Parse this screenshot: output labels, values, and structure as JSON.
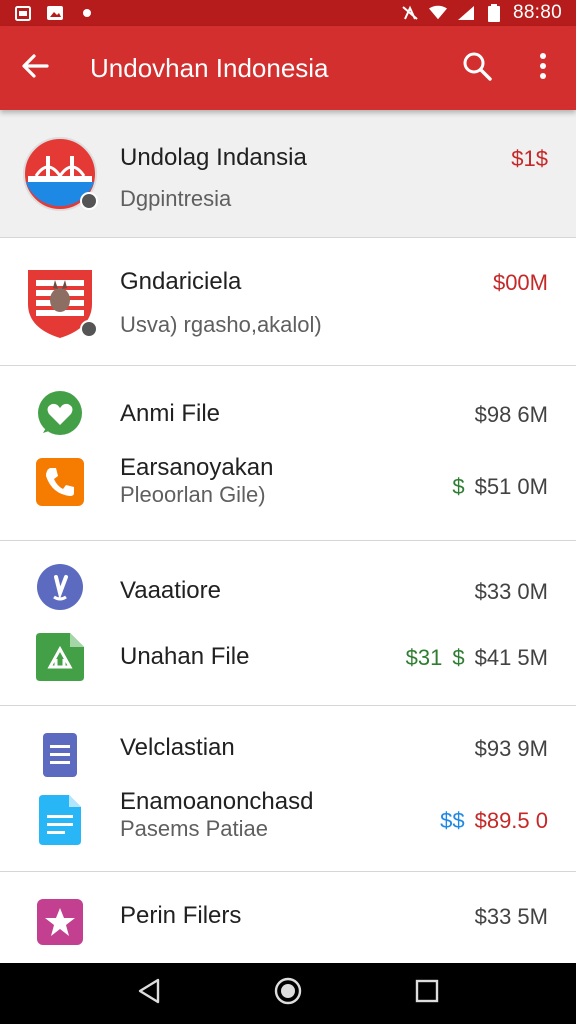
{
  "status_bar": {
    "time": "88:80",
    "icons": [
      "calendar-icon",
      "image-icon",
      "dot-icon",
      "signal-off-icon",
      "wifi-icon",
      "cell-signal-icon",
      "battery-icon"
    ]
  },
  "app_bar": {
    "title": "Undovhan Indonesia",
    "back_icon": "arrow-back-icon",
    "search_icon": "search-icon",
    "menu_icon": "more-vert-icon"
  },
  "groups": [
    {
      "rows": [
        {
          "title": "Undolag Indansia",
          "subtitle": "Dgpintresia",
          "amounts": [
            {
              "text": "$1$",
              "color": "red"
            }
          ],
          "icon": "flag-bridge-icon"
        }
      ]
    },
    {
      "rows": [
        {
          "title": "Gndariciela",
          "subtitle": "Usva) rgasho,akalol)",
          "amounts": [
            {
              "text": "$00M",
              "color": "red"
            }
          ],
          "icon": "kangaroo-flag-icon"
        }
      ]
    },
    {
      "rows": [
        {
          "title": "Anmi File",
          "subtitle": "",
          "amounts": [
            {
              "text": "$98 6M",
              "color": "gray"
            }
          ],
          "icon": "chat-bubble-icon"
        },
        {
          "title": "Earsanoyakan",
          "subtitle": "Pleoorlan Gile)",
          "amounts": [
            {
              "text": "$",
              "color": "green"
            },
            {
              "text": "$51 0M",
              "color": "gray"
            }
          ],
          "icon": "phone-icon"
        }
      ]
    },
    {
      "rows": [
        {
          "title": "Vaaatiore",
          "subtitle": "",
          "amounts": [
            {
              "text": "$33 0M",
              "color": "gray"
            }
          ],
          "icon": "viber-icon"
        },
        {
          "title": "Unahan File",
          "subtitle": "",
          "amounts": [
            {
              "text": "$31",
              "color": "green"
            },
            {
              "text": "$",
              "color": "green"
            },
            {
              "text": "$41 5M",
              "color": "gray"
            }
          ],
          "icon": "green-file-icon"
        }
      ]
    },
    {
      "rows": [
        {
          "title": "Velclastian",
          "subtitle": "",
          "amounts": [
            {
              "text": "$93 9M",
              "color": "gray"
            }
          ],
          "icon": "document-icon"
        },
        {
          "title": "Enamoanonchasd",
          "subtitle": "Pasems Patiae",
          "amounts": [
            {
              "text": "$$",
              "color": "blue"
            },
            {
              "text": "$89.5 0",
              "color": "red"
            }
          ],
          "icon": "doc-file-icon"
        }
      ]
    },
    {
      "rows": [
        {
          "title": "Perin Filers",
          "subtitle": "",
          "amounts": [
            {
              "text": "$33 5M",
              "color": "gray"
            }
          ],
          "icon": "star-icon"
        }
      ]
    }
  ],
  "nav_bar": {
    "back": "nav-back-icon",
    "home": "nav-home-icon",
    "recents": "nav-recents-icon"
  },
  "colors": {
    "app_bar": "#d32f2f",
    "status_bar": "#b71c1c",
    "amount_red": "#c62828",
    "amount_green": "#2e7d32",
    "amount_blue": "#1e88e5"
  }
}
